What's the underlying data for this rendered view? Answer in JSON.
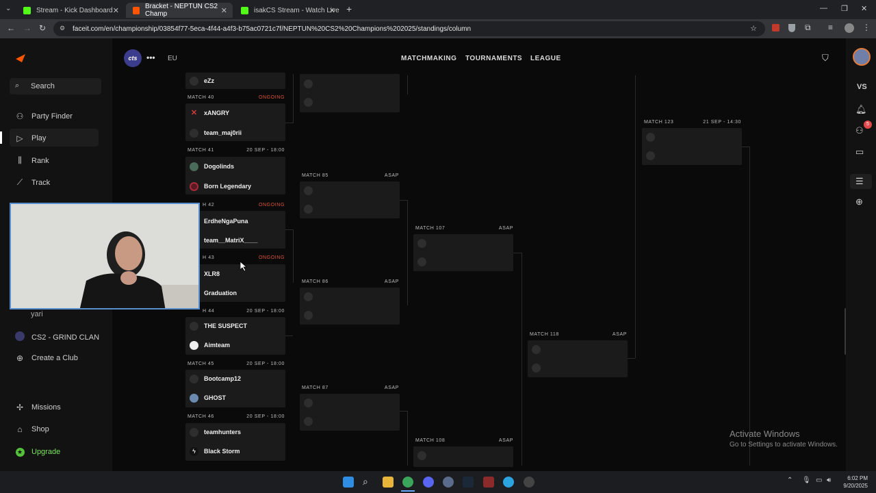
{
  "browser": {
    "tabs": [
      {
        "label": "Stream - Kick Dashboard",
        "color": "#53fc18"
      },
      {
        "label": "Bracket - NEPTUN CS2 Champ",
        "color": "#ff5500"
      },
      {
        "label": "isakCS Stream - Watch Live",
        "color": "#53fc18"
      }
    ],
    "url": "faceit.com/en/championship/03854f77-5eca-4f44-a4f3-b75ac0721c7f/NEPTUN%20CS2%20Champions%202025/standings/column"
  },
  "sidebar": {
    "search_label": "Search",
    "items": [
      {
        "label": "Party Finder",
        "icon": "party-finder-icon"
      },
      {
        "label": "Play",
        "icon": "play-icon"
      },
      {
        "label": "Rank",
        "icon": "rank-icon"
      },
      {
        "label": "Track",
        "icon": "track-icon"
      }
    ],
    "club_partial": "yari",
    "club": "CS2 - GRIND CLAN",
    "create_club": "Create a Club",
    "missions": "Missions",
    "shop": "Shop",
    "upgrade": "Upgrade"
  },
  "topnav": {
    "region": "EU",
    "links": [
      "MATCHMAKING",
      "TOURNAMENTS",
      "LEAGUE"
    ]
  },
  "bracket": {
    "round1": [
      {
        "label": "",
        "status": "",
        "teams": [
          "eZz",
          ""
        ]
      },
      {
        "label": "MATCH 40",
        "status": "ONGOING",
        "teams": [
          "xANGRY",
          "team_maj0rii"
        ]
      },
      {
        "label": "MATCH 41",
        "status": "20 SEP - 18:00",
        "teams": [
          "Dogolinds",
          "Born Legendary"
        ]
      },
      {
        "label": "H 42",
        "status": "ONGOING",
        "teams": [
          "ErdheNgaPuna",
          "team__MatriX____"
        ]
      },
      {
        "label": "H 43",
        "status": "ONGOING",
        "teams": [
          "XLR8",
          "Graduation"
        ]
      },
      {
        "label": "H 44",
        "status": "20 SEP - 18:00",
        "teams": [
          "THE SUSPECT",
          "Aimteam"
        ]
      },
      {
        "label": "MATCH 45",
        "status": "20 SEP - 18:00",
        "teams": [
          "Bootcamp12",
          "GHOST"
        ]
      },
      {
        "label": "MATCH 46",
        "status": "20 SEP - 18:00",
        "teams": [
          "teamhunters",
          "Black Storm"
        ]
      }
    ],
    "round2": [
      {
        "label": "MATCH 85",
        "status": "ASAP"
      },
      {
        "label": "MATCH 86",
        "status": "ASAP"
      },
      {
        "label": "MATCH 87",
        "status": "ASAP"
      }
    ],
    "round3": [
      {
        "label": "MATCH 107",
        "status": "ASAP"
      },
      {
        "label": "MATCH 108",
        "status": "ASAP"
      }
    ],
    "round4": [
      {
        "label": "MATCH 118",
        "status": "ASAP"
      }
    ],
    "round5": [
      {
        "label": "MATCH 123",
        "status": "21 SEP - 14:30"
      }
    ]
  },
  "rail": {
    "vs": "VS",
    "notif_count": "5"
  },
  "watermark": {
    "title": "Activate Windows",
    "sub": "Go to Settings to activate Windows."
  },
  "clock": {
    "time": "6:02 PM",
    "date": "9/20/2025"
  }
}
